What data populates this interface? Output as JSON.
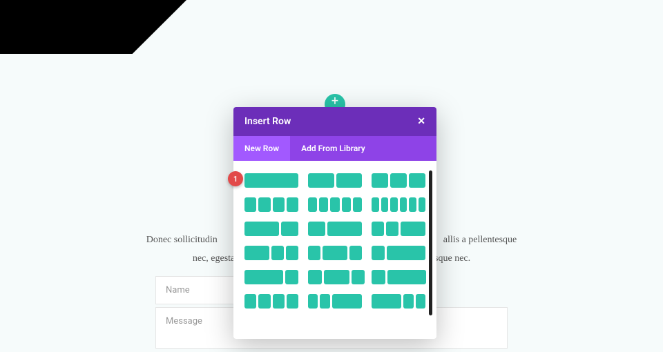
{
  "add_button_glyph": "+",
  "page": {
    "text_line1": "Donec sollicitudin",
    "text_line1b": "allis a pellentesque",
    "text_line2a": "nec, egestas",
    "text_line2b": "atesque nec."
  },
  "form": {
    "name_placeholder": "Name",
    "message_placeholder": "Message"
  },
  "modal": {
    "title": "Insert Row",
    "close_glyph": "✕",
    "tabs": {
      "new_row": "New Row",
      "add_from_library": "Add From Library"
    }
  },
  "badge": {
    "label": "1"
  },
  "colors": {
    "accent_teal": "#29c4a9",
    "purple_header": "#6c2eb9",
    "purple_tabs": "#8e43e7",
    "purple_active": "#a259ff",
    "badge_red": "#e24a4a"
  },
  "layouts": [
    {
      "cols": [
        "c1"
      ]
    },
    {
      "cols": [
        "c1",
        "c1"
      ]
    },
    {
      "cols": [
        "c1",
        "c1",
        "c1"
      ]
    },
    {
      "cols": [
        "c1",
        "c1",
        "c1",
        "c1"
      ]
    },
    {
      "cols": [
        "c1",
        "c1",
        "c1",
        "c1",
        "c1"
      ]
    },
    {
      "cols": [
        "c1",
        "c1",
        "c1",
        "c1",
        "c1",
        "c1"
      ]
    },
    {
      "cols": [
        "c2",
        "c1"
      ]
    },
    {
      "cols": [
        "c1",
        "c2"
      ]
    },
    {
      "cols": [
        "c1",
        "c1",
        "c2"
      ]
    },
    {
      "cols": [
        "c2",
        "c1",
        "c1"
      ]
    },
    {
      "cols": [
        "c1",
        "c2",
        "c1"
      ]
    },
    {
      "cols": [
        "c1",
        "c3"
      ]
    },
    {
      "cols": [
        "c3",
        "c1"
      ]
    },
    {
      "cols": [
        "c14",
        "c12",
        "c14"
      ]
    },
    {
      "cols": [
        "c14",
        "c34"
      ]
    },
    {
      "cols": [
        "c1",
        "c1",
        "c1",
        "c1"
      ]
    },
    {
      "cols": [
        "c1",
        "c1",
        "c3"
      ]
    },
    {
      "cols": [
        "c3",
        "c1",
        "c1"
      ]
    }
  ]
}
